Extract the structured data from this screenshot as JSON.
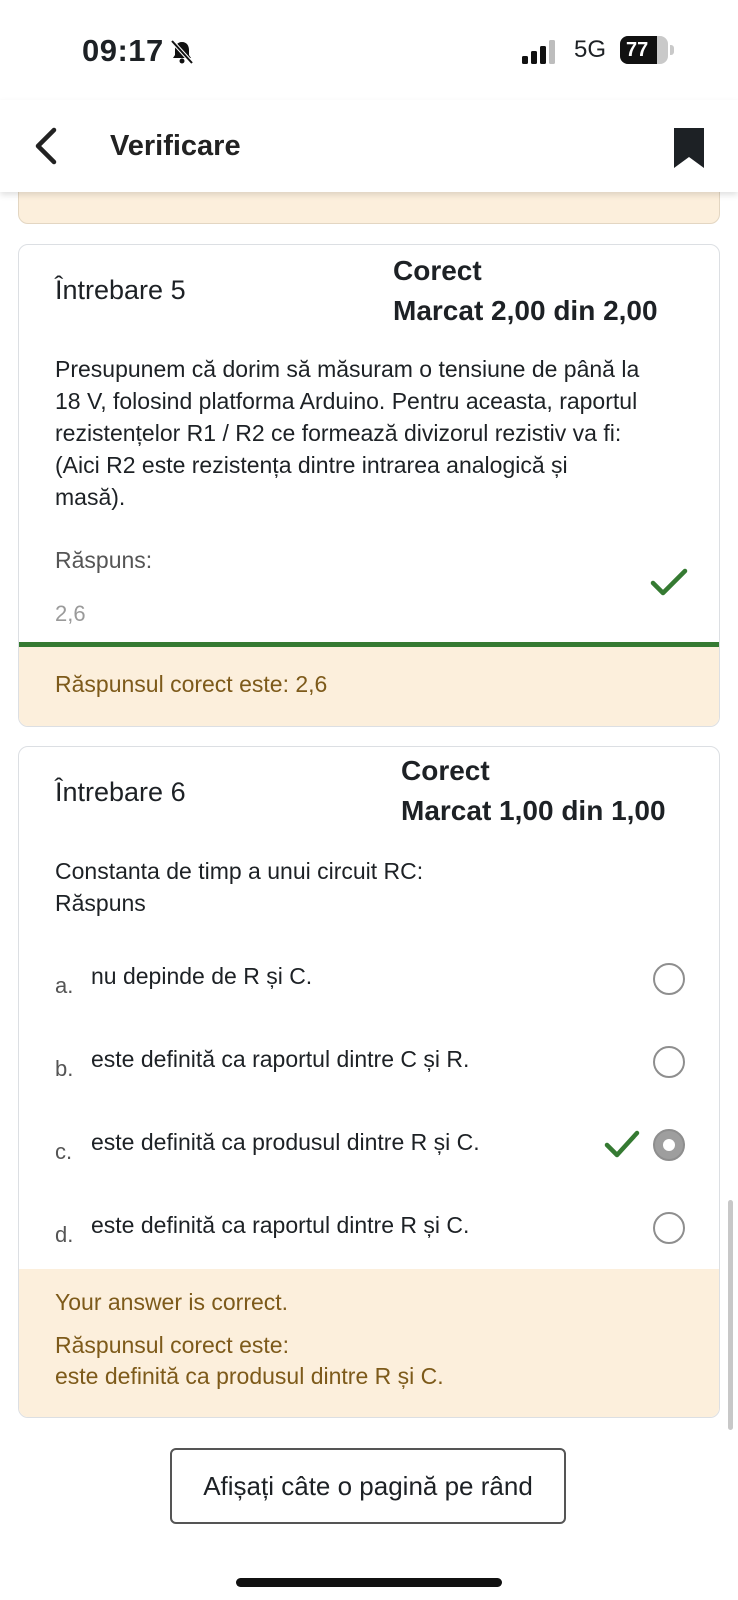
{
  "status_bar": {
    "time": "09:17",
    "network": "5G",
    "battery": "77",
    "battery_level_pct": 77,
    "icons": [
      "bell-slash-icon",
      "signal-icon",
      "battery-icon"
    ]
  },
  "header": {
    "title": "Verificare",
    "back_icon": "chevron-left-icon",
    "bookmark_icon": "bookmark-icon"
  },
  "question5": {
    "label": "Întrebare 5",
    "state": "Corect",
    "mark": "Marcat 2,00 din 2,00",
    "text_lines": [
      "Presupunem că dorim să măsuram o tensiune de până la",
      "18 V, folosind platforma Arduino. Pentru aceasta, raportul",
      "rezistențelor R1 / R2 ce formează divizorul rezistiv va fi:",
      "(Aici R2 este rezistența dintre intrarea analogică și",
      "masă)."
    ],
    "answer_label": "Răspuns:",
    "answer_value": "2,6",
    "feedback": "Răspunsul corect este: 2,6"
  },
  "question6": {
    "label": "Întrebare 6",
    "state": "Corect",
    "mark": "Marcat 1,00 din 1,00",
    "text": "Constanta de timp a unui circuit RC:",
    "answer_label": "Răspuns",
    "options": [
      {
        "letter": "a.",
        "text": "nu depinde de R și C.",
        "selected": false
      },
      {
        "letter": "b.",
        "text": "este definită ca raportul dintre C și R.",
        "selected": false
      },
      {
        "letter": "c.",
        "text": "este definită ca produsul dintre R și C.",
        "selected": true
      },
      {
        "letter": "d.",
        "text": "este definită ca raportul dintre R și C.",
        "selected": false
      }
    ],
    "feedback_status": "Your answer is correct.",
    "feedback_label": "Răspunsul corect este:",
    "feedback_answer": "este definită ca produsul dintre R și C."
  },
  "footer": {
    "button_label": "Afișați câte o pagină pe rând"
  },
  "colors": {
    "accent_green": "#357a32",
    "feedback_bg": "#fcefdc",
    "feedback_text": "#7d5a1a"
  }
}
